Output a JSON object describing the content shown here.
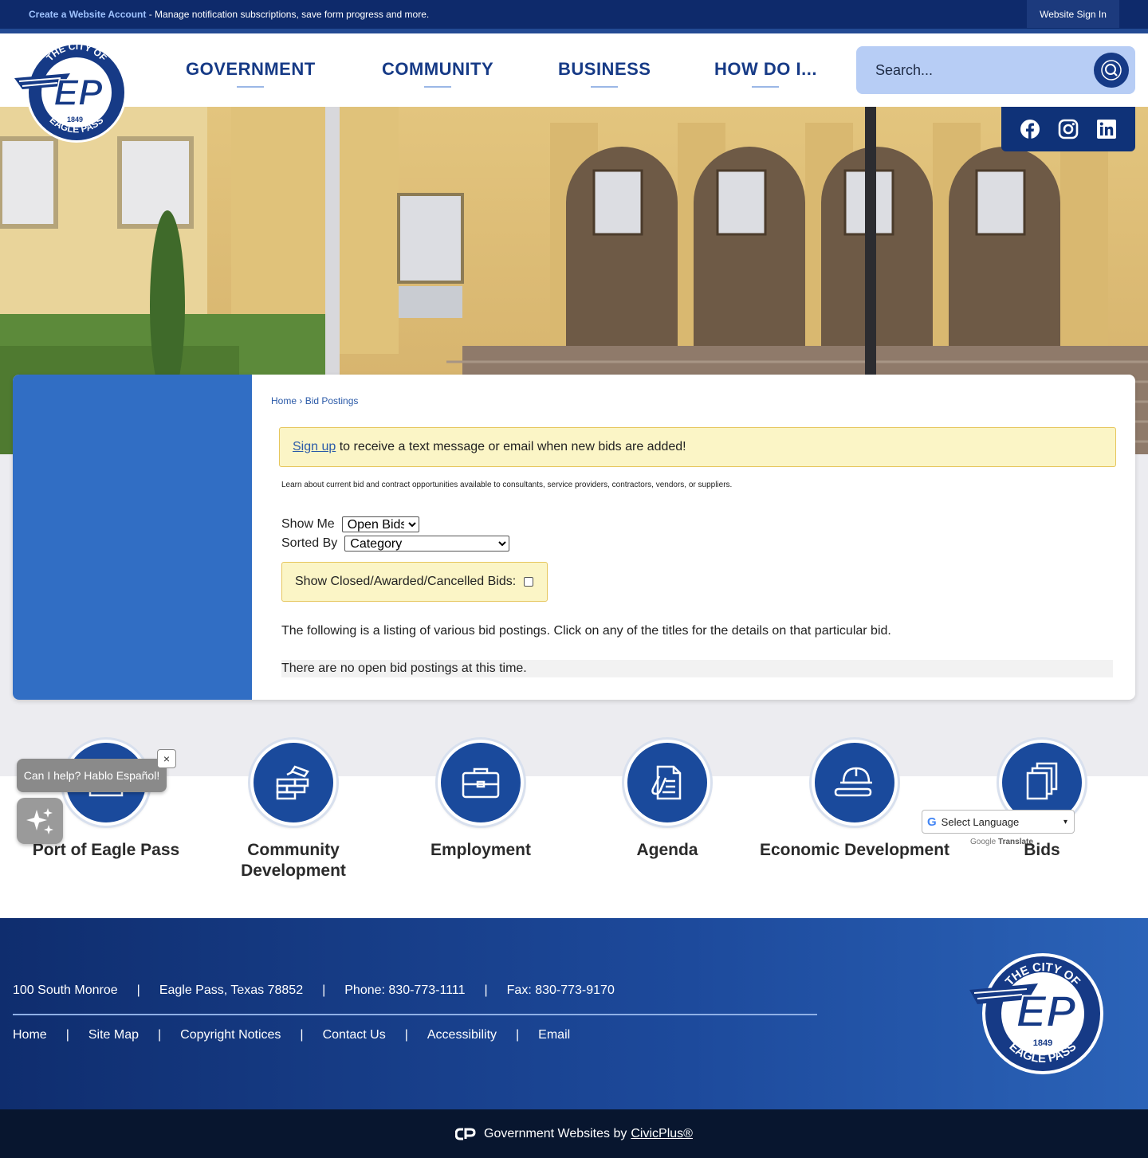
{
  "topbar": {
    "account_link": "Create a Website Account",
    "account_msg": " - Manage notification subscriptions, save form progress and more.",
    "signin_label": "Website Sign In"
  },
  "logo": {
    "top_text": "THE CITY OF",
    "initials": "EP",
    "year": "1849",
    "bottom_text": "EAGLE PASS"
  },
  "nav": {
    "items": [
      {
        "label": "GOVERNMENT"
      },
      {
        "label": "COMMUNITY"
      },
      {
        "label": "BUSINESS"
      },
      {
        "label": "HOW DO I..."
      }
    ]
  },
  "search": {
    "placeholder": "Search..."
  },
  "social": [
    "facebook-icon",
    "instagram-icon",
    "linkedin-icon"
  ],
  "breadcrumb": {
    "home": "Home",
    "sep": "›",
    "current": "Bid Postings"
  },
  "notice": {
    "link": "Sign up",
    "text": " to receive a text message or email when new bids are added!"
  },
  "intro": "Learn about current bid and contract opportunities available to consultants, service providers, contractors, vendors, or suppliers.",
  "filters": {
    "show_me_label": "Show Me",
    "show_me_value": "Open Bids",
    "sorted_by_label": "Sorted By",
    "sorted_by_value": "Category",
    "closed_label": "Show Closed/Awarded/Cancelled Bids:"
  },
  "listing_text": "The following is a listing of various bid postings. Click on any of the titles for the details on that particular bid.",
  "no_bids_text": "There are no open bid postings at this time.",
  "quick_links": [
    {
      "label": "Port of Eagle Pass"
    },
    {
      "label": "Community Development"
    },
    {
      "label": "Employment"
    },
    {
      "label": "Agenda"
    },
    {
      "label": "Economic Development"
    },
    {
      "label": "Bids"
    }
  ],
  "chat": {
    "text": "Can I help? Hablo Español!",
    "close": "×"
  },
  "translate": {
    "label": "Select Language",
    "powered_by": "Google",
    "translate": "Translate"
  },
  "footer": {
    "address": "100 South Monroe",
    "city": "Eagle Pass, Texas 78852",
    "phone": "Phone: 830-773-1111",
    "fax": "Fax: 830-773-9170",
    "separator": "|",
    "links": [
      "Home",
      "Site Map",
      "Copyright Notices",
      "Contact Us",
      "Accessibility",
      "Email"
    ]
  },
  "bottombar": {
    "text": "Government Websites by",
    "brand": "CivicPlus®"
  },
  "colors": {
    "primary": "#163a86",
    "sidebar": "#316ec4",
    "notice_bg": "#fbf5c6",
    "footer_dark": "#08162f"
  }
}
